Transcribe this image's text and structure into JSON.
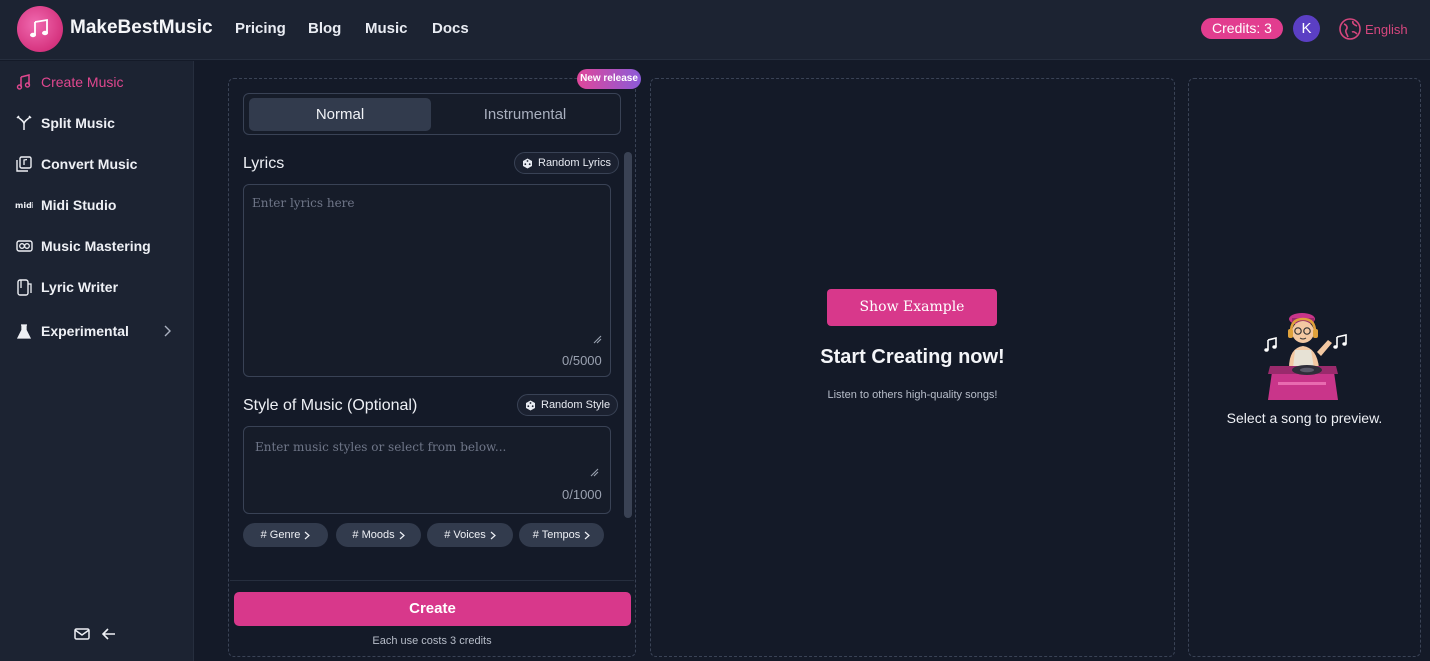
{
  "header": {
    "brand": "MakeBestMusic",
    "nav": [
      "Pricing",
      "Blog",
      "Music",
      "Docs"
    ],
    "credits": "Credits: 3",
    "avatar_initial": "K",
    "language": "English"
  },
  "sidebar": {
    "items": [
      {
        "label": "Create Music",
        "icon": "music-note-icon",
        "active": true
      },
      {
        "label": "Split Music",
        "icon": "split-icon"
      },
      {
        "label": "Convert Music",
        "icon": "convert-icon"
      },
      {
        "label": "Midi Studio",
        "icon": "midi-icon"
      },
      {
        "label": "Music Mastering",
        "icon": "mastering-icon"
      },
      {
        "label": "Lyric Writer",
        "icon": "lyric-writer-icon"
      },
      {
        "label": "Experimental",
        "icon": "flask-icon"
      }
    ]
  },
  "form": {
    "badge": "New release",
    "mode_tabs": [
      "Normal",
      "Instrumental"
    ],
    "lyrics_label": "Lyrics",
    "random_lyrics": "Random Lyrics",
    "lyrics_placeholder": "Enter lyrics here",
    "lyrics_counter": "0/5000",
    "style_label": "Style of Music  (Optional)",
    "random_style": "Random Style",
    "style_placeholder": "Enter music styles or select from below...",
    "style_counter": "0/1000",
    "chips": [
      "# Genre",
      "# Moods",
      "# Voices",
      "# Tempos"
    ],
    "create_label": "Create",
    "cost_note": "Each use costs 3 credits"
  },
  "main": {
    "show_example": "Show Example",
    "title": "Start Creating now!",
    "subtitle": "Listen to others high-quality songs!"
  },
  "preview": {
    "text": "Select a song to preview."
  },
  "colors": {
    "accent": "#d8388b",
    "background": "#141a28",
    "panel": "#1c2332"
  }
}
